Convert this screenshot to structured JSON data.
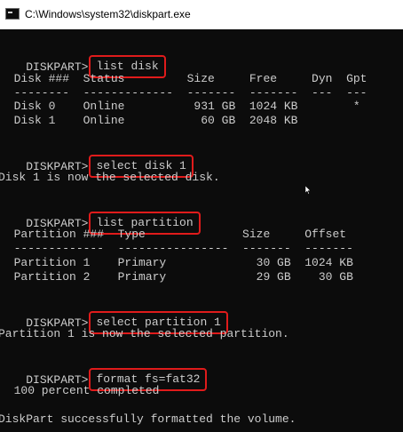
{
  "window": {
    "title": "C:\\Windows\\system32\\diskpart.exe"
  },
  "console": {
    "prompt": "DISKPART>",
    "commands": {
      "list_disk": "list disk",
      "select_disk": "select disk 1",
      "list_partition": "list partition",
      "select_partition": "select partition 1",
      "format": "format fs=fat32"
    },
    "disk_table": {
      "header": "  Disk ###  Status         Size     Free     Dyn  Gpt",
      "separator": "  --------  -------------  -------  -------  ---  ---",
      "rows": [
        "  Disk 0    Online          931 GB  1024 KB        *",
        "  Disk 1    Online           60 GB  2048 KB"
      ]
    },
    "select_disk_result": "Disk 1 is now the selected disk.",
    "partition_table": {
      "header": "  Partition ###  Type              Size     Offset",
      "separator": "  -------------  ----------------  -------  -------",
      "rows": [
        "  Partition 1    Primary             30 GB  1024 KB",
        "  Partition 2    Primary             29 GB    30 GB"
      ]
    },
    "select_partition_result": "Partition 1 is now the selected partition.",
    "format_progress": "  100 percent completed",
    "format_result": "DiskPart successfully formatted the volume."
  },
  "colors": {
    "background": "#0c0c0c",
    "text": "#cccccc",
    "highlight_border": "#e01b1b"
  },
  "icons": {
    "app": "console-window-icon",
    "pointer": "mouse-cursor-icon"
  }
}
